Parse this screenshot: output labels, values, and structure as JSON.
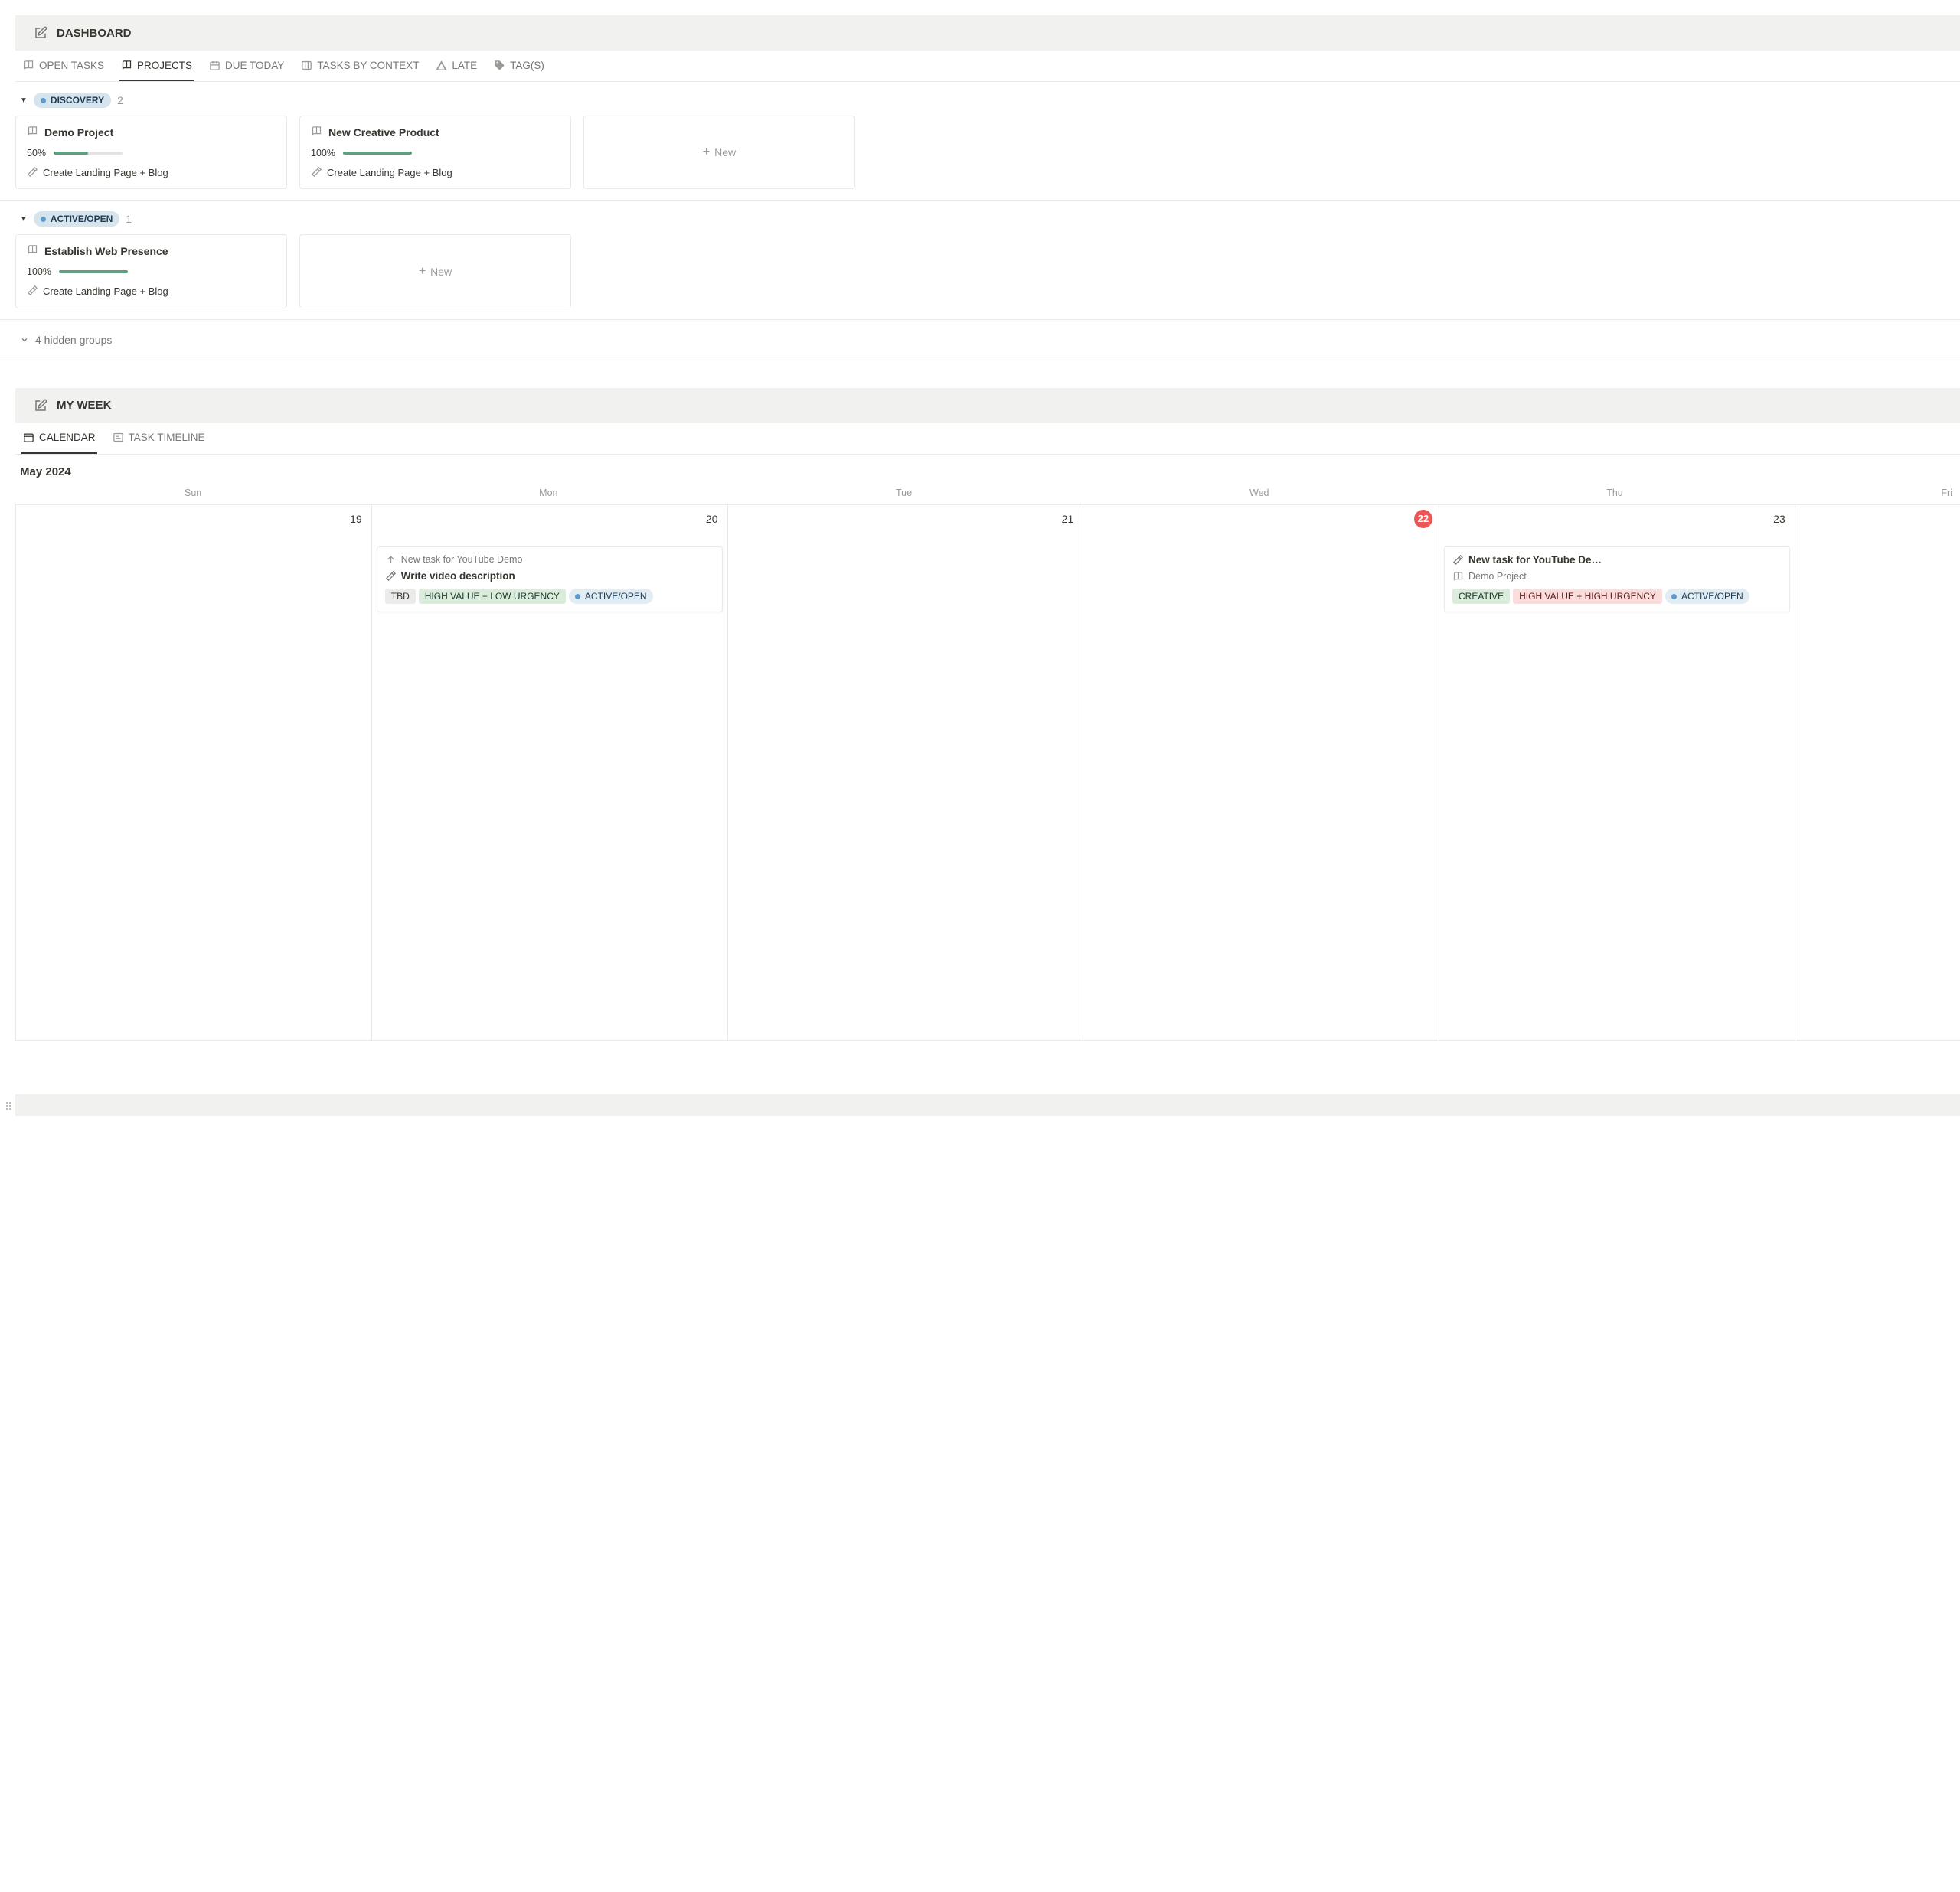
{
  "dashboard": {
    "title": "DASHBOARD",
    "views": [
      {
        "icon": "book",
        "label": "OPEN TASKS",
        "active": false
      },
      {
        "icon": "book",
        "label": "PROJECTS",
        "active": true
      },
      {
        "icon": "calendar",
        "label": "DUE TODAY",
        "active": false
      },
      {
        "icon": "board",
        "label": "TASKS BY CONTEXT",
        "active": false
      },
      {
        "icon": "warn",
        "label": "LATE",
        "active": false
      },
      {
        "icon": "tag",
        "label": "TAG(S)",
        "active": false
      }
    ],
    "groups": [
      {
        "name": "DISCOVERY",
        "count": "2",
        "cards": [
          {
            "title": "Demo Project",
            "pct_label": "50%",
            "pct": 50,
            "sub": "Create Landing Page + Blog"
          },
          {
            "title": "New Creative Product",
            "pct_label": "100%",
            "pct": 100,
            "sub": "Create Landing Page + Blog"
          }
        ]
      },
      {
        "name": "ACTIVE/OPEN",
        "count": "1",
        "cards": [
          {
            "title": "Establish Web Presence",
            "pct_label": "100%",
            "pct": 100,
            "sub": "Create Landing Page + Blog"
          }
        ]
      }
    ],
    "hidden_groups_label": "4 hidden groups",
    "new_label": "New"
  },
  "myweek": {
    "title": "MY WEEK",
    "views": [
      {
        "icon": "cal",
        "label": "CALENDAR",
        "active": true
      },
      {
        "icon": "timeline",
        "label": "TASK TIMELINE",
        "active": false
      }
    ],
    "month_label": "May 2024",
    "headers": [
      "Sun",
      "Mon",
      "Tue",
      "Wed",
      "Thu",
      "Fri"
    ],
    "days": [
      {
        "date": "19",
        "today": false,
        "events": []
      },
      {
        "date": "20",
        "today": false,
        "events": [
          {
            "parent": "New task for YouTube Demo",
            "title": "Write video description",
            "project": null,
            "tags": [
              {
                "text": "TBD",
                "cls": "gray"
              },
              {
                "text": "HIGH VALUE + LOW URGENCY",
                "cls": "green"
              },
              {
                "text": "ACTIVE/OPEN",
                "cls": "bluep",
                "dot": true
              }
            ]
          }
        ]
      },
      {
        "date": "21",
        "today": false,
        "events": []
      },
      {
        "date": "22",
        "today": true,
        "events": []
      },
      {
        "date": "23",
        "today": false,
        "events": [
          {
            "parent": null,
            "title": "New task for YouTube De…",
            "project": "Demo Project",
            "tags": [
              {
                "text": "CREATIVE",
                "cls": "green"
              },
              {
                "text": "HIGH VALUE + HIGH URGENCY",
                "cls": "red"
              },
              {
                "text": "ACTIVE/OPEN",
                "cls": "bluep",
                "dot": true
              }
            ]
          }
        ]
      },
      {
        "date": "",
        "today": false,
        "events": [],
        "edge": true
      }
    ]
  }
}
